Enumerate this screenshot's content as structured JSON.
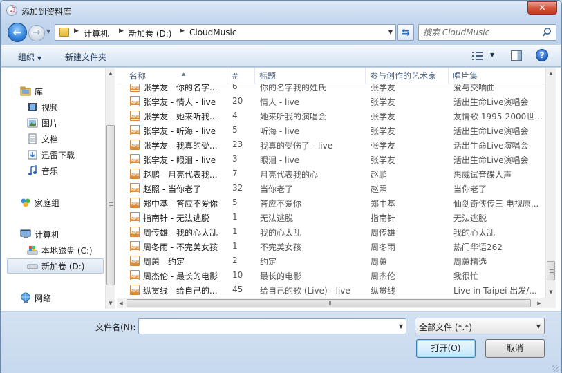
{
  "window": {
    "title": "添加到资料库",
    "close_glyph": "✕"
  },
  "nav": {
    "back_glyph": "←",
    "forward_glyph": "→",
    "breadcrumb": [
      "计算机",
      "新加卷 (D:)",
      "CloudMusic"
    ],
    "refresh_glyph": "⇆"
  },
  "search": {
    "placeholder": "搜索 CloudMusic"
  },
  "toolbar": {
    "organize": "组织",
    "new_folder": "新建文件夹",
    "help_glyph": "?"
  },
  "sidebar": {
    "items": [
      {
        "label": "库",
        "icon": "library-icon"
      },
      {
        "label": "视频",
        "icon": "video-icon"
      },
      {
        "label": "图片",
        "icon": "picture-icon"
      },
      {
        "label": "文档",
        "icon": "document-icon"
      },
      {
        "label": "迅雷下载",
        "icon": "download-icon"
      },
      {
        "label": "音乐",
        "icon": "music-icon"
      },
      {
        "label": "家庭组",
        "icon": "homegroup-icon"
      },
      {
        "label": "计算机",
        "icon": "computer-icon"
      },
      {
        "label": "本地磁盘 (C:)",
        "icon": "drive-c-icon"
      },
      {
        "label": "新加卷 (D:)",
        "icon": "drive-d-icon"
      },
      {
        "label": "网络",
        "icon": "network-icon"
      }
    ]
  },
  "file_list": {
    "columns": [
      "名称",
      "#",
      "标题",
      "参与创作的艺术家",
      "唱片集"
    ],
    "rows": [
      {
        "name": "张学友 - 你的名字...",
        "num": "6",
        "title": "你的名字我的姓氏",
        "artist": "张学友",
        "album": "爱与交响曲"
      },
      {
        "name": "张学友 - 情人 - live",
        "num": "20",
        "title": "情人 - live",
        "artist": "张学友",
        "album": "活出生命Live演唱会"
      },
      {
        "name": "张学友 - 她来听我...",
        "num": "4",
        "title": "她来听我的演唱会",
        "artist": "张学友",
        "album": "友情歌 1995-2000世..."
      },
      {
        "name": "张学友 - 听海 - live",
        "num": "5",
        "title": "听海 - live",
        "artist": "张学友",
        "album": "活出生命Live演唱会"
      },
      {
        "name": "张学友 - 我真的受...",
        "num": "23",
        "title": "我真的受伤了 - live",
        "artist": "张学友",
        "album": "活出生命Live演唱会"
      },
      {
        "name": "张学友 - 眼泪 - live",
        "num": "3",
        "title": "眼泪 - live",
        "artist": "张学友",
        "album": "活出生命Live演唱会"
      },
      {
        "name": "赵鹏 - 月亮代表我...",
        "num": "7",
        "title": "月亮代表我的心",
        "artist": "赵鹏",
        "album": "惠威试音碟人声"
      },
      {
        "name": "赵照 - 当你老了",
        "num": "32",
        "title": "当你老了",
        "artist": "赵照",
        "album": "当你老了"
      },
      {
        "name": "郑中基 - 答应不爱你",
        "num": "5",
        "title": "答应不爱你",
        "artist": "郑中基",
        "album": "仙剑奇侠传三 电视原..."
      },
      {
        "name": "指南针 - 无法逃脱",
        "num": "1",
        "title": "无法逃脱",
        "artist": "指南针",
        "album": "无法逃脱"
      },
      {
        "name": "周传雄 - 我的心太乱",
        "num": "1",
        "title": "我的心太乱",
        "artist": "周传雄",
        "album": "我的心太乱"
      },
      {
        "name": "周冬雨 - 不完美女孩",
        "num": "1",
        "title": "不完美女孩",
        "artist": "周冬雨",
        "album": "热门华语262"
      },
      {
        "name": "周蕙 - 约定",
        "num": "2",
        "title": "约定",
        "artist": "周蕙",
        "album": "周蕙精选"
      },
      {
        "name": "周杰伦 - 最长的电影",
        "num": "10",
        "title": "最长的电影",
        "artist": "周杰伦",
        "album": "我很忙"
      },
      {
        "name": "纵贯线 - 给自己的...",
        "num": "45",
        "title": "给自己的歌 (Live) - live",
        "artist": "纵贯线",
        "album": "Live in Taipei 出发/..."
      }
    ]
  },
  "footer": {
    "filename_label": "文件名(N):",
    "filename_value": "",
    "file_type": "全部文件 (*.*)",
    "open_label": "打开(O)",
    "cancel_label": "取消"
  }
}
